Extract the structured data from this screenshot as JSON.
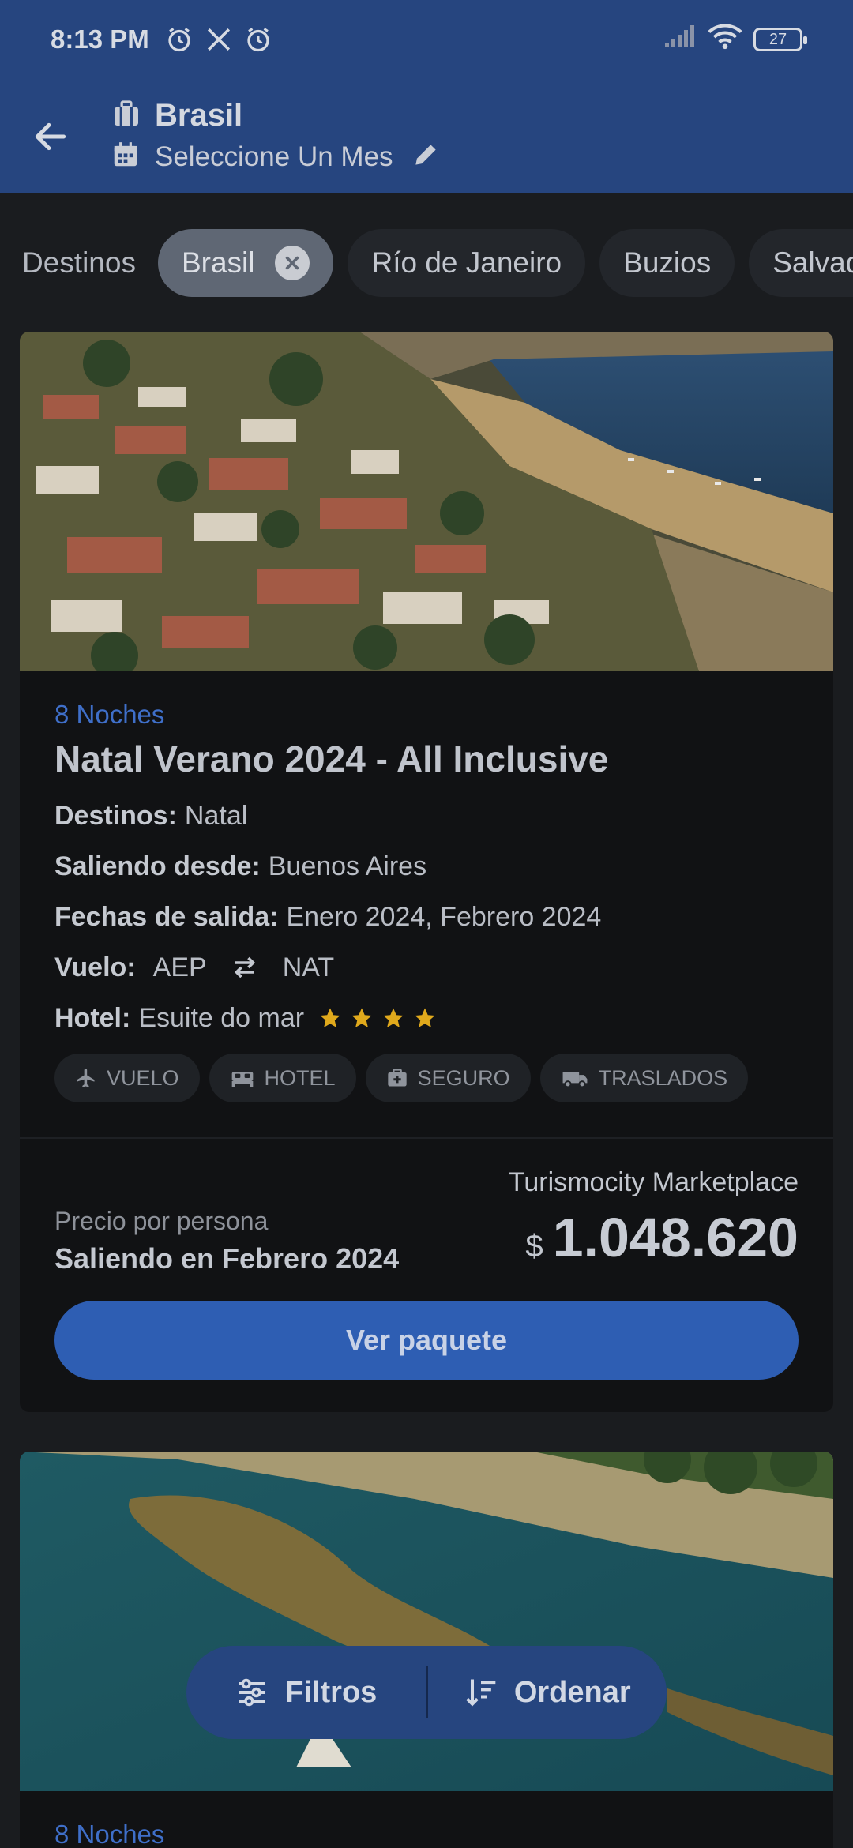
{
  "status_bar": {
    "time": "8:13 PM",
    "battery": "27",
    "icons": [
      "alarm-icon",
      "x-logo-icon",
      "alarm-icon",
      "signal-icon",
      "wifi-icon",
      "battery-icon"
    ]
  },
  "header": {
    "title": "Brasil",
    "subtitle": "Seleccione Un Mes"
  },
  "chips": {
    "label": "Destinos",
    "items": [
      "Brasil",
      "Río de Janeiro",
      "Buzios",
      "Salvador"
    ]
  },
  "card1": {
    "nights": "8 Noches",
    "title": "Natal Verano 2024 - All Inclusive",
    "destinos_label": "Destinos:",
    "destinos": "Natal",
    "saliendo_label": "Saliendo desde:",
    "saliendo": "Buenos Aires",
    "fechas_label": "Fechas de salida:",
    "fechas": "Enero 2024, Febrero 2024",
    "vuelo_label": "Vuelo:",
    "vuelo_from": "AEP",
    "vuelo_to": "NAT",
    "hotel_label": "Hotel:",
    "hotel": "Esuite do mar",
    "hotel_stars": 4,
    "tags": [
      "VUELO",
      "HOTEL",
      "SEGURO",
      "TRASLADOS"
    ],
    "price_label": "Precio por persona",
    "price_when": "Saliendo en Febrero 2024",
    "marketplace": "Turismocity Marketplace",
    "currency": "$",
    "price": "1.048.620",
    "cta": "Ver paquete"
  },
  "card2": {
    "nights": "8 Noches"
  },
  "bottom_bar": {
    "filters": "Filtros",
    "sort": "Ordenar"
  },
  "colors": {
    "header_bg": "#26457f",
    "accent": "#2e5eb3",
    "star": "#e0a91c"
  }
}
